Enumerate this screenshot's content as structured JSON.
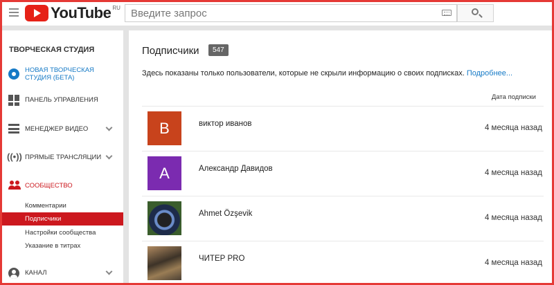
{
  "header": {
    "logo_text": "YouTube",
    "logo_region": "RU",
    "search_placeholder": "Введите запрос"
  },
  "sidebar": {
    "title": "ТВОРЧЕСКАЯ СТУДИЯ",
    "items": [
      {
        "label": "НОВАЯ ТВОРЧЕСКАЯ СТУДИЯ (БЕТА)",
        "icon": "gear-icon"
      },
      {
        "label": "ПАНЕЛЬ УПРАВЛЕНИЯ",
        "icon": "dashboard-icon"
      },
      {
        "label": "МЕНЕДЖЕР ВИДЕО",
        "icon": "video-manager-icon"
      },
      {
        "label": "ПРЯМЫЕ ТРАНСЛЯЦИИ",
        "icon": "live-icon"
      },
      {
        "label": "СООБЩЕСТВО",
        "icon": "community-icon"
      },
      {
        "label": "КАНАЛ",
        "icon": "channel-icon"
      }
    ],
    "community_subitems": [
      {
        "label": "Комментарии"
      },
      {
        "label": "Подписчики"
      },
      {
        "label": "Настройки сообщества"
      },
      {
        "label": "Указание в титрах"
      }
    ]
  },
  "main": {
    "title": "Подписчики",
    "count": "547",
    "info_text": "Здесь показаны только пользователи, которые не скрыли информацию о своих подписках.",
    "info_link": "Подробнее...",
    "date_header": "Дата подписки",
    "subscribers": [
      {
        "name": "виктор иванов",
        "date": "4 месяца назад",
        "avatar_letter": "B",
        "avatar_color": "#c8431c"
      },
      {
        "name": "Александр Давидов",
        "date": "4 месяца назад",
        "avatar_letter": "A",
        "avatar_color": "#7b2bb0"
      },
      {
        "name": "Ahmet Özşevik",
        "date": "4 месяца назад",
        "avatar_letter": "",
        "avatar_color": ""
      },
      {
        "name": "ЧИТЕР PRO",
        "date": "4 месяца назад",
        "avatar_letter": "",
        "avatar_color": ""
      }
    ]
  },
  "colors": {
    "brand_red": "#e62117",
    "accent_blue": "#167ac6",
    "community_red": "#cc181e",
    "frame_red": "#e53935"
  }
}
